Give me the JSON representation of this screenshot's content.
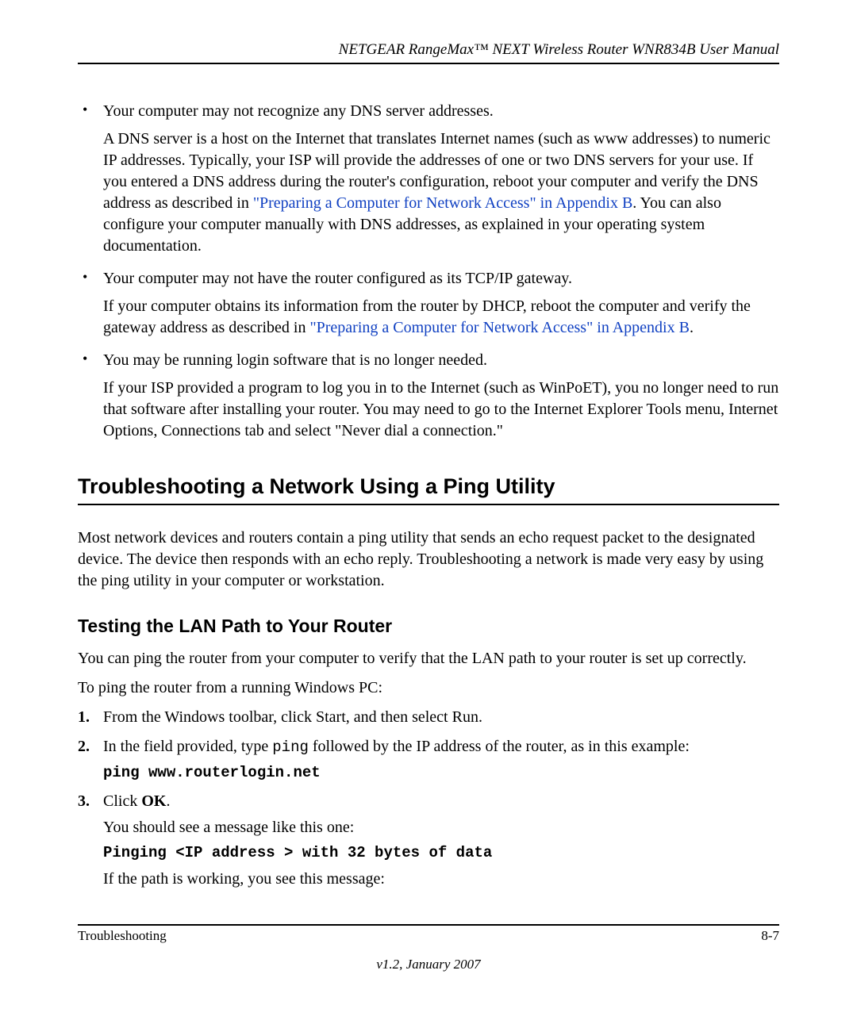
{
  "header": {
    "title": "NETGEAR RangeMax™ NEXT Wireless Router WNR834B User Manual"
  },
  "bullets": [
    {
      "lead": "Your computer may not recognize any DNS server addresses.",
      "body_pre": "A DNS server is a host on the Internet that translates Internet names (such as www addresses) to numeric IP addresses. Typically, your ISP will provide the addresses of one or two DNS servers for your use. If you entered a DNS address during the router's configuration, reboot your computer and verify the DNS address as described in ",
      "link": "\"Preparing a Computer for Network Access\" in Appendix B",
      "body_post": ". You can also configure your computer manually with DNS addresses, as explained in your operating system documentation."
    },
    {
      "lead": "Your computer may not have the router configured as its TCP/IP gateway.",
      "body_pre": "If your computer obtains its information from the router by DHCP, reboot the computer and verify the gateway address as described in ",
      "link": "\"Preparing a Computer for Network Access\" in Appendix B",
      "body_post": "."
    },
    {
      "lead": "You may be running login software that is no longer needed.",
      "body_pre": "If your ISP provided a program to log you in to the Internet (such as WinPoET), you no longer need to run that software after installing your router. You may need to go to the Internet Explorer Tools menu, Internet Options, Connections tab and select \"Never dial a connection.\"",
      "link": "",
      "body_post": ""
    }
  ],
  "section": {
    "heading": "Troubleshooting a Network Using a Ping Utility",
    "intro": "Most network devices and routers contain a ping utility that sends an echo request packet to the designated device. The device then responds with an echo reply. Troubleshooting a network is made very easy by using the ping utility in your computer or workstation.",
    "subheading": "Testing the LAN Path to Your Router",
    "sub_intro1": "You can ping the router from your computer to verify that the LAN path to your router is set up correctly.",
    "sub_intro2": "To ping the router from a running Windows PC:",
    "steps": [
      {
        "num": "1.",
        "text_pre": "From the Windows toolbar, click Start, and then select Run.",
        "mono": "",
        "text_post": "",
        "code_line": "",
        "extra1": "",
        "extra_code": "",
        "extra2": ""
      },
      {
        "num": "2.",
        "text_pre": "In the field provided, type ",
        "mono": "ping",
        "text_post": " followed by the IP address of the router, as in this example:",
        "code_line": "ping www.routerlogin.net",
        "extra1": "",
        "extra_code": "",
        "extra2": ""
      },
      {
        "num": "3.",
        "text_pre": "Click ",
        "bold": "OK",
        "text_post": ".",
        "code_line": "",
        "extra1": "You should see a message like this one:",
        "extra_code": "Pinging <IP address > with 32 bytes of data",
        "extra2": "If the path is working, you see this message:"
      }
    ]
  },
  "footer": {
    "left": "Troubleshooting",
    "right": "8-7",
    "version": "v1.2, January 2007"
  }
}
